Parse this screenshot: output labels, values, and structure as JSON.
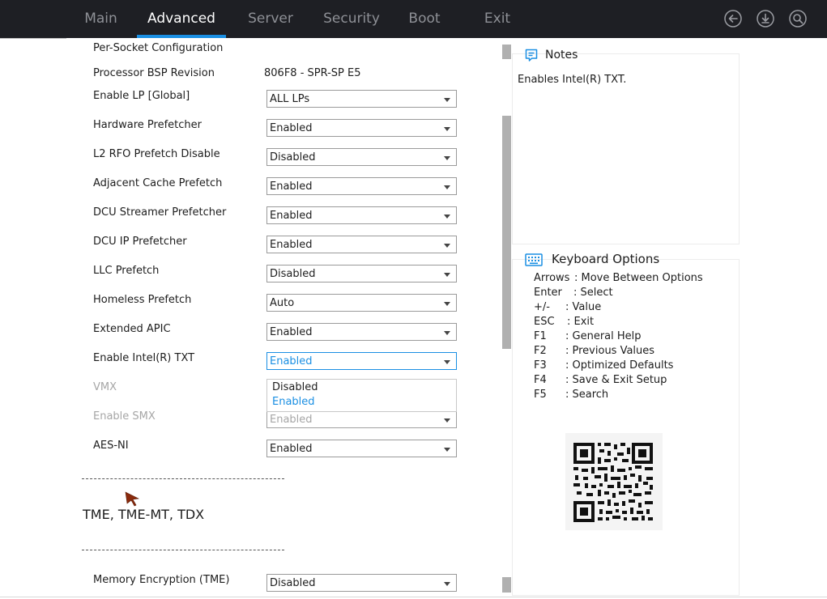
{
  "tabs": [
    {
      "label": "Main",
      "active": false
    },
    {
      "label": "Advanced",
      "active": true
    },
    {
      "label": "Server",
      "active": false
    },
    {
      "label": "Security",
      "active": false
    },
    {
      "label": "Boot",
      "active": false
    },
    {
      "label": "Exit",
      "active": false
    }
  ],
  "nav_icons": [
    "back-icon",
    "download-icon",
    "search-icon"
  ],
  "colors": {
    "accent": "#1a8fe3",
    "topbar": "#1e1f24",
    "inactive_tab": "#8e9096",
    "disabled_text": "#a6a6a6"
  },
  "settings": {
    "header": "Per-Socket Configuration",
    "bsp_label": "Processor BSP Revision",
    "bsp_value": "806F8 - SPR-SP E5",
    "rows": [
      {
        "label": "Enable LP [Global]",
        "value": "ALL LPs",
        "state": "normal"
      },
      {
        "label": "Hardware Prefetcher",
        "value": "Enabled",
        "state": "normal"
      },
      {
        "label": "L2 RFO Prefetch Disable",
        "value": "Disabled",
        "state": "normal"
      },
      {
        "label": "Adjacent Cache Prefetch",
        "value": "Enabled",
        "state": "normal"
      },
      {
        "label": "DCU Streamer Prefetcher",
        "value": "Enabled",
        "state": "normal"
      },
      {
        "label": "DCU IP Prefetcher",
        "value": "Enabled",
        "state": "normal"
      },
      {
        "label": "LLC Prefetch",
        "value": "Disabled",
        "state": "normal"
      },
      {
        "label": "Homeless Prefetch",
        "value": "Auto",
        "state": "normal"
      },
      {
        "label": "Extended APIC",
        "value": "Enabled",
        "state": "normal"
      },
      {
        "label": "Enable Intel(R) TXT",
        "value": "Enabled",
        "state": "focused"
      },
      {
        "label": "VMX",
        "value": "",
        "state": "disabled"
      },
      {
        "label": "Enable SMX",
        "value": "Enabled",
        "state": "disabled"
      },
      {
        "label": "AES-NI",
        "value": "Enabled",
        "state": "normal"
      }
    ],
    "dropdown_options": [
      {
        "label": "Disabled",
        "selected": false
      },
      {
        "label": "Enabled",
        "selected": true
      }
    ],
    "separator": "-----------------------------------------------",
    "section_title": "TME, TME-MT, TDX",
    "tme_row": {
      "label": "Memory Encryption (TME)",
      "value": "Disabled"
    }
  },
  "notes": {
    "title": "Notes",
    "text": "Enables Intel(R) TXT."
  },
  "keyboard": {
    "title": "Keyboard Options",
    "lines": [
      {
        "key": "Arrows",
        "desc": ": Move Between Options"
      },
      {
        "key": "Enter",
        "desc": ": Select"
      },
      {
        "key": "+/-",
        "desc": ": Value"
      },
      {
        "key": "ESC",
        "desc": ": Exit"
      },
      {
        "key": "F1",
        "desc": ": General Help"
      },
      {
        "key": "F2",
        "desc": ": Previous Values"
      },
      {
        "key": "F3",
        "desc": ": Optimized Defaults"
      },
      {
        "key": "F4",
        "desc": ": Save & Exit Setup"
      },
      {
        "key": "F5",
        "desc": ": Search"
      }
    ]
  }
}
